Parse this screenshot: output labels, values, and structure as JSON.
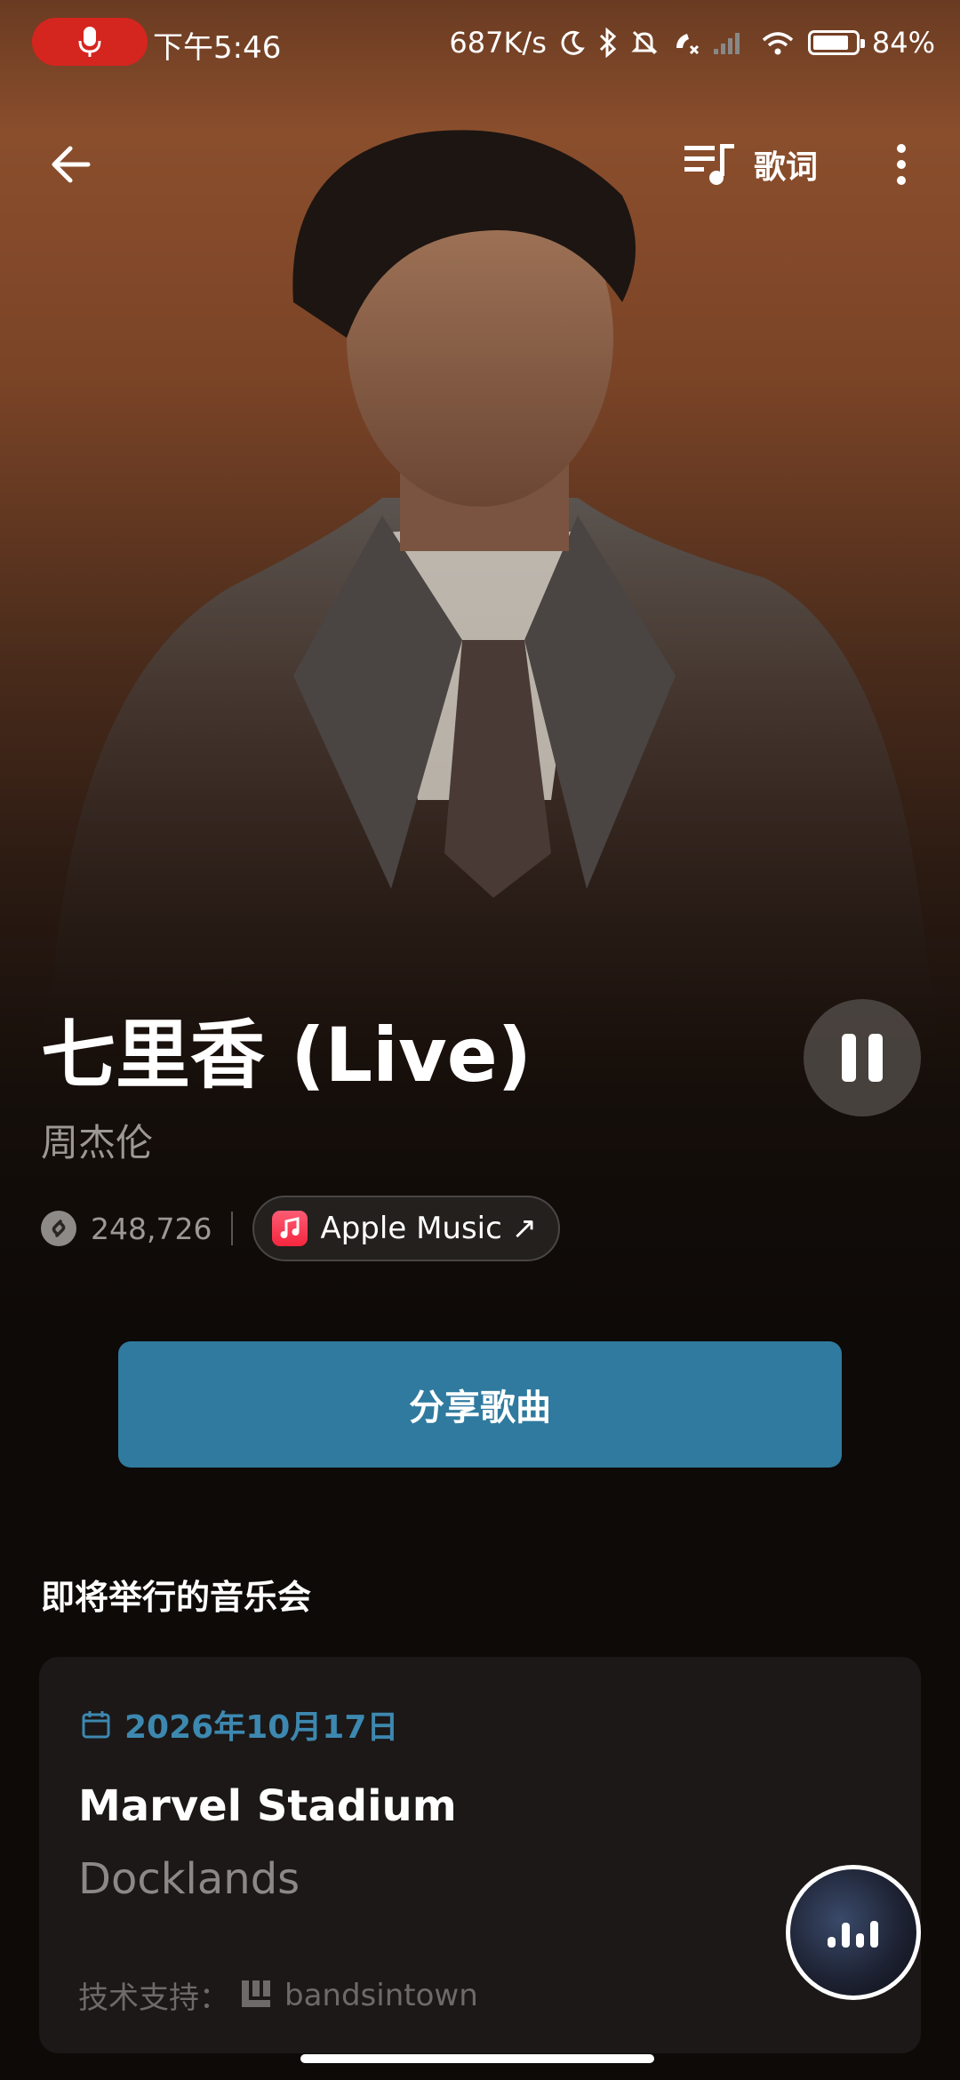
{
  "status": {
    "time": "下午5:46",
    "speed": "687K/s",
    "battery": "84%",
    "battery_level": 0.84
  },
  "toolbar": {
    "lyrics_label": "歌词"
  },
  "song": {
    "title": "七里香 (Live)",
    "artist": "周杰伦",
    "shazam_count": "248,726",
    "apple_music_label": "Apple Music ↗"
  },
  "share": {
    "label": "分享歌曲"
  },
  "concerts": {
    "section_title": "即将举行的音乐会",
    "items": [
      {
        "date": "2026年10月17日",
        "venue": "Marvel Stadium",
        "city": "Docklands"
      }
    ],
    "powered_by_label": "技术支持：",
    "powered_by_name": "bandsintown"
  },
  "colors": {
    "accent": "#2f7a9e",
    "date_accent": "#3d88b0",
    "record_pill": "#d5251f"
  }
}
